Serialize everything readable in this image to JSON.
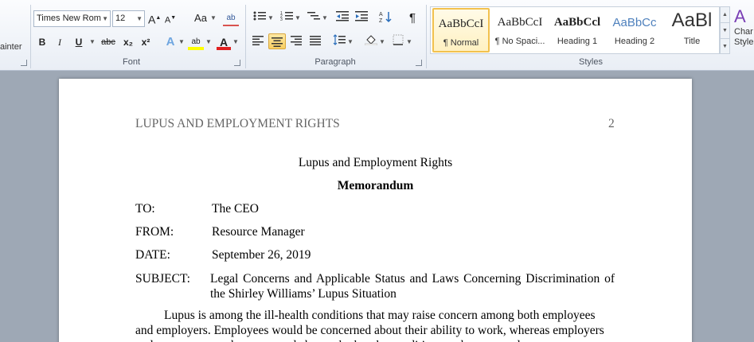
{
  "ribbon": {
    "clipboard": {
      "painter_label": "ainter"
    },
    "font": {
      "group_label": "Font",
      "font_name": "Times New Rom",
      "font_size": "12",
      "grow": "A",
      "shrink": "A",
      "change_case": "Aa",
      "clear_format": "ab",
      "bold": "B",
      "italic": "I",
      "underline": "U",
      "strike": "abc",
      "subscript": "x₂",
      "superscript": "x²",
      "effects": "A",
      "highlight": "ab",
      "font_color": "A"
    },
    "paragraph": {
      "group_label": "Paragraph",
      "pilcrow": "¶"
    },
    "styles": {
      "group_label": "Styles",
      "items": [
        {
          "sample": "AaBbCcI",
          "name": "¶ Normal"
        },
        {
          "sample": "AaBbCcI",
          "name": "¶ No Spaci..."
        },
        {
          "sample": "AaBbCcl",
          "name": "Heading 1"
        },
        {
          "sample": "AaBbCc",
          "name": "Heading 2"
        },
        {
          "sample": "AaBl",
          "name": "Title"
        }
      ],
      "change_styles_label_1": "Char",
      "change_styles_label_2": "Style"
    }
  },
  "document": {
    "running_head": "LUPUS AND EMPLOYMENT RIGHTS",
    "page_number": "2",
    "title": "Lupus and Employment Rights",
    "subtitle": "Memorandum",
    "memo": {
      "to_label": "TO:",
      "to_value": "The CEO",
      "from_label": "FROM:",
      "from_value": "Resource Manager",
      "date_label": "DATE:",
      "date_value": "September 26, 2019",
      "subject_label": "SUBJECT:",
      "subject_value": "Legal Concerns and Applicable Status and Laws Concerning Discrimination of the Shirley Williams’ Lupus Situation"
    },
    "body": "Lupus is among the ill-health conditions that may raise concern among both employees and employers. Employees would be concerned about their ability to work, whereas employers and managers may be concerned about whether the condition can be managed"
  },
  "colors": {
    "ribbon_bg": "#e9eef5",
    "doc_bg": "#9ea8b5",
    "selected_style": "#f8cf62",
    "heading_blue": "#4f81bd"
  }
}
